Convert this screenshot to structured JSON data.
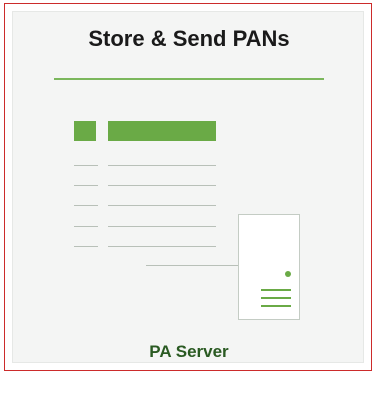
{
  "title": "Store & Send PANs",
  "server_label": "PA Server",
  "colors": {
    "border": "#cc2b2b",
    "accent": "#6aaa46",
    "label": "#2a5a22"
  },
  "icons": {
    "document": "document-list-icon",
    "server": "server-icon"
  }
}
